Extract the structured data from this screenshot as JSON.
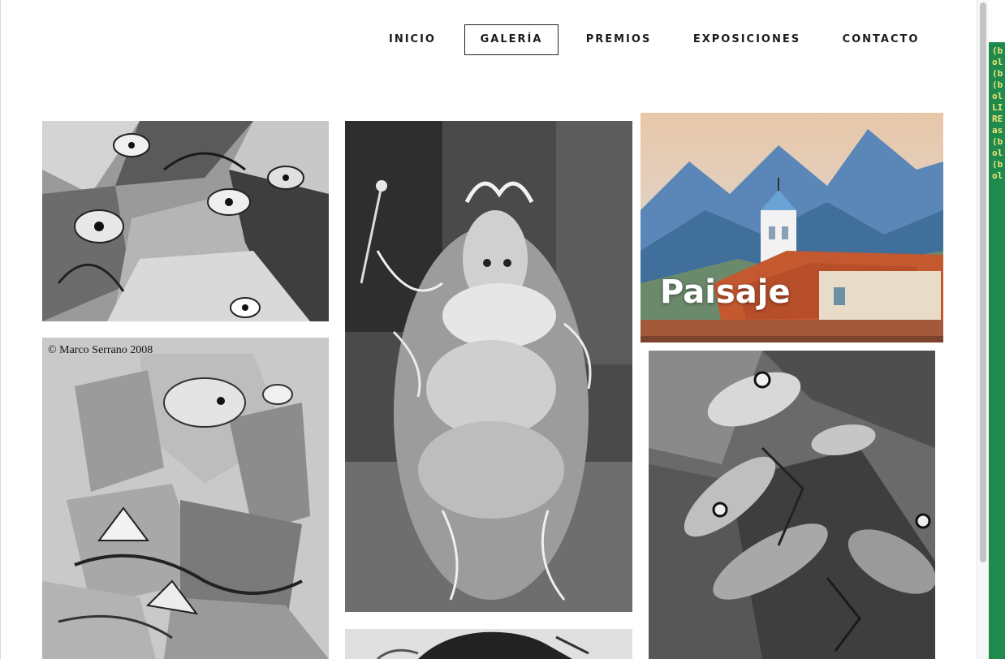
{
  "nav": {
    "items": [
      {
        "label": "INICIO"
      },
      {
        "label": "GALERÍA",
        "active": true
      },
      {
        "label": "PREMIOS"
      },
      {
        "label": "EXPOSICIONES"
      },
      {
        "label": "CONTACTO"
      }
    ]
  },
  "gallery": {
    "tiles": [
      {
        "id": "birds-painting"
      },
      {
        "id": "feathered-figure-painting"
      },
      {
        "id": "landscape-painting",
        "label": "Paisaje"
      },
      {
        "id": "cubist-horse-painting",
        "caption": "© Marco Serrano 2008"
      },
      {
        "id": "fish-painting"
      },
      {
        "id": "bottom-partial-painting"
      }
    ]
  },
  "side_panel": {
    "lines": [
      "(b",
      "ol",
      "(b",
      "(b",
      "ol",
      "LI",
      "RE",
      "as",
      "(b",
      "ol",
      "(b",
      "ol"
    ]
  },
  "colors": {
    "nav_text": "#1c1c1c",
    "active_border": "#222222",
    "side_panel": "#1e8a4c",
    "side_text": "#f2e37a"
  }
}
